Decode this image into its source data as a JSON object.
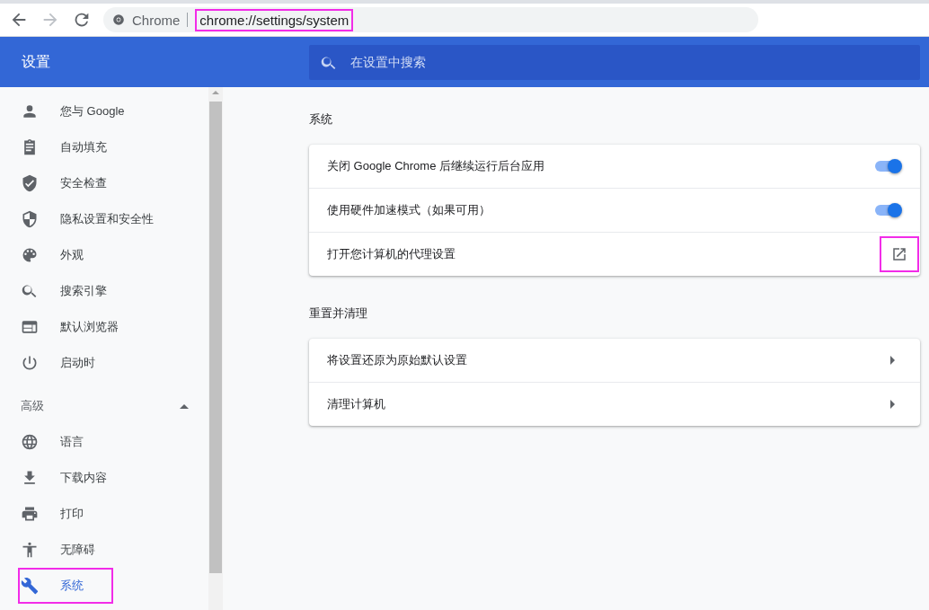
{
  "toolbar": {
    "back_enabled": true,
    "forward_enabled": false,
    "site_label": "Chrome",
    "url": "chrome://settings/system",
    "url_highlighted": true
  },
  "header": {
    "title": "设置",
    "search": {
      "placeholder": "在设置中搜索"
    }
  },
  "sidebar": {
    "items": [
      {
        "label": "您与 Google",
        "selected": false
      },
      {
        "label": "自动填充",
        "selected": false
      },
      {
        "label": "安全检查",
        "selected": false
      },
      {
        "label": "隐私设置和安全性",
        "selected": false
      },
      {
        "label": "外观",
        "selected": false
      },
      {
        "label": "搜索引擎",
        "selected": false
      },
      {
        "label": "默认浏览器",
        "selected": false
      },
      {
        "label": "启动时",
        "selected": false
      }
    ],
    "advanced": {
      "label": "高级",
      "expanded": true,
      "items": [
        {
          "label": "语言",
          "selected": false,
          "highlighted": false
        },
        {
          "label": "下载内容",
          "selected": false,
          "highlighted": false
        },
        {
          "label": "打印",
          "selected": false,
          "highlighted": false
        },
        {
          "label": "无障碍",
          "selected": false,
          "highlighted": false
        },
        {
          "label": "系统",
          "selected": true,
          "highlighted": true
        }
      ]
    }
  },
  "sections": [
    {
      "title": "系统",
      "rows": [
        {
          "kind": "toggle",
          "label": "关闭 Google Chrome 后继续运行后台应用",
          "checked": true
        },
        {
          "kind": "toggle",
          "label": "使用硬件加速模式（如果可用）",
          "checked": true
        },
        {
          "kind": "external",
          "label": "打开您计算机的代理设置",
          "highlighted": true
        }
      ]
    },
    {
      "title": "重置并清理",
      "rows": [
        {
          "kind": "subpage",
          "label": "将设置还原为原始默认设置"
        },
        {
          "kind": "subpage",
          "label": "清理计算机"
        }
      ]
    }
  ]
}
